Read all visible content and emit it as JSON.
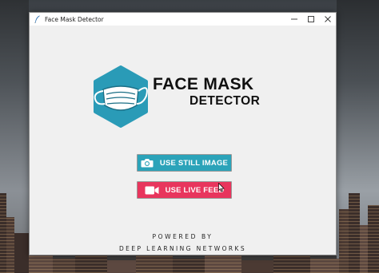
{
  "window": {
    "title": "Face Mask Detector",
    "controls": {
      "minimize": "—",
      "maximize": "☐",
      "close": "✕"
    }
  },
  "logo": {
    "line1": "FACE MASK",
    "line2": "DETECTOR",
    "hex_color": "#2a9bb7"
  },
  "buttons": {
    "still_image": {
      "label": "USE STILL IMAGE",
      "icon": "camera-icon",
      "color": "#2ba3b9"
    },
    "live_feed": {
      "label": "USE LIVE FEED",
      "icon": "video-camera-icon",
      "color": "#e8355d"
    }
  },
  "footer": {
    "powered_by": "POWERED BY",
    "company": "DEEP LEARNING NETWORKS"
  }
}
